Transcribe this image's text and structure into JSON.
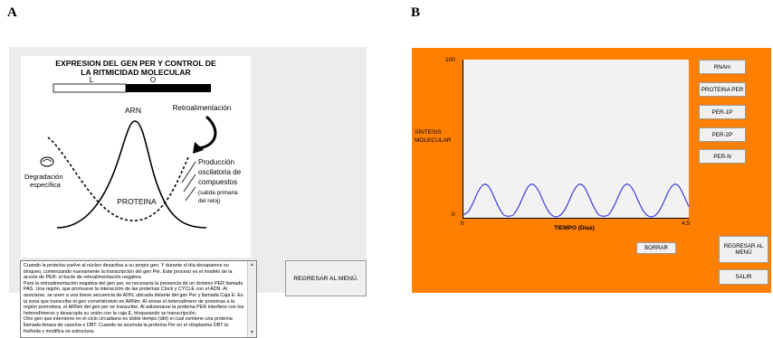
{
  "panel_labels": {
    "a": "A",
    "b": "B"
  },
  "panel_a": {
    "diagram": {
      "title_line1": "EXPRESION DEL GEN PER Y CONTROL DE",
      "title_line2": "LA RITMICIDAD MOLECULAR",
      "bar_light_label": "L",
      "bar_dark_label": "O",
      "arn_label": "ARN",
      "feedback_label": "Retroalimentación",
      "degradation_line1": "Degradación",
      "degradation_line2": "específica",
      "protein_label": "PROTEINA",
      "production_line1": "Producción",
      "production_line2": "oscilatoria de",
      "production_line3": "compuestos",
      "output_line1": "(salida primaria",
      "output_line2": "del reloj)"
    },
    "description_lines": [
      "Cuando la proteína vuelve al núcleo desactiva a su propio gen. Y durante el día desaparece su",
      "bloqueo, comenzando nuevamente la transcripción del gen Per. Este proceso es el modelo de la",
      "acción de PER: el bucle de retroalimentación negativa.",
      "Para la retroalimentación negativa del gen per, es necesaria la presencia de un dominio PER llamado",
      "PAS. Una región, que promueve la interacción de las proteínas Clock y CYCLE con el ADN. Al",
      "asociarse, se unen a una breve secuencia de ADN, ubicada delante del gen Per y llamada Caja E. Es",
      "la zona que transcribe el gen convirtiéndolo en ARNm. Al unirse el heterodímero de proteínas a la",
      "región promotora, el ARNm del gen per se transcribe. Al adicionarse la proteína PER interfiere con los",
      "heterodímeros y desacopla su unión con la caja E, bloqueando se transcripción.",
      "Otro gen que interviene en el ciclo circadiano es doble tiempo (dbt) el cual contiene una proteína",
      "llamada kinasa de caseína o DBT.  Cuando se acumula la proteína Per en el citoplasma DBT la",
      "fosforila y modifica se estructura."
    ],
    "return_button": "REGRESAR AL MENÚ."
  },
  "panel_b": {
    "ylabel_line1": "SÍNTESIS",
    "ylabel_line2": "MOLECULAR",
    "xlabel": "TIEMPO (Días)",
    "buttons": [
      "RNAm",
      "PROTEINA PER",
      "PER-1P",
      "PER-2P",
      "PER-N"
    ],
    "erase_button": "BORRAR",
    "return_button": "REGRESAR AL MENÚ",
    "exit_button": "SALIR",
    "colors": {
      "background": "#ff7f00",
      "curve": "#3a3ad8"
    }
  },
  "chart_data": {
    "type": "line",
    "xlabel": "TIEMPO (Días)",
    "ylabel": "SÍNTESIS MOLECULAR",
    "xlim": [
      0,
      4.5
    ],
    "ylim": [
      0,
      100
    ],
    "x_ticks": [
      "0",
      "4.5"
    ],
    "y_ticks": [
      "0",
      "100"
    ],
    "series": [
      {
        "x": [
          0,
          0.1,
          0.2,
          0.3,
          0.4,
          0.5,
          0.6,
          0.7,
          0.8,
          0.9,
          1.0,
          1.1,
          1.2,
          1.3,
          1.4,
          1.5,
          1.6,
          1.7,
          1.8,
          1.9,
          2.0,
          2.1,
          2.2,
          2.3,
          2.4,
          2.5,
          2.6,
          2.7,
          2.8,
          2.9,
          3.0,
          3.1,
          3.2,
          3.3,
          3.4,
          3.5,
          3.6,
          3.7,
          3.8,
          3.9,
          4.0,
          4.1,
          4.2,
          4.3,
          4.4,
          4.5
        ],
        "y": [
          2,
          4,
          10,
          17,
          21,
          20,
          14,
          7,
          2,
          1,
          2,
          7,
          14,
          20,
          21,
          17,
          10,
          4,
          1,
          1,
          4,
          10,
          17,
          21,
          20,
          14,
          7,
          2,
          1,
          2,
          7,
          14,
          20,
          21,
          17,
          10,
          4,
          1,
          1,
          4,
          10,
          17,
          21,
          20,
          14,
          7
        ]
      }
    ]
  }
}
